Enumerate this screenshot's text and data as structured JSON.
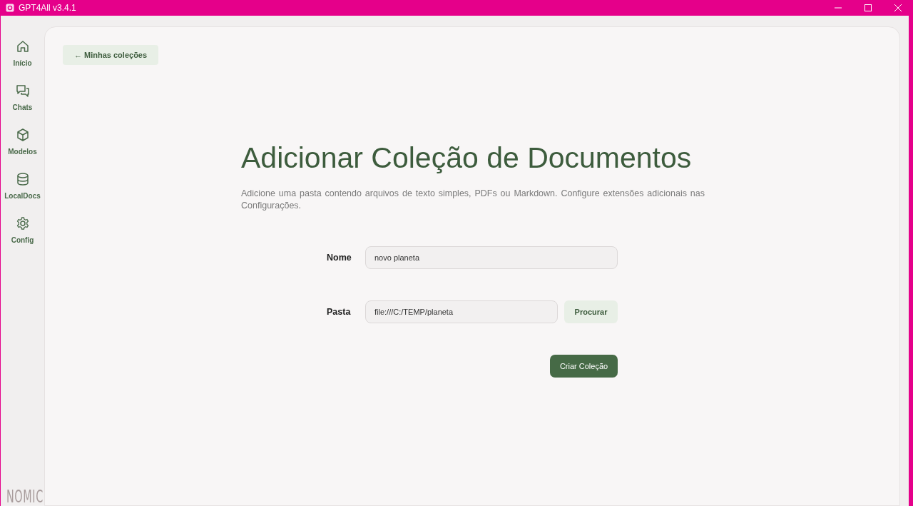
{
  "window": {
    "title": "GPT4All v3.4.1"
  },
  "sidebar": {
    "items": [
      {
        "label": "Início",
        "kind": "home"
      },
      {
        "label": "Chats",
        "kind": "chats"
      },
      {
        "label": "Modelos",
        "kind": "models"
      },
      {
        "label": "LocalDocs",
        "kind": "docs"
      },
      {
        "label": "Config",
        "kind": "settings"
      }
    ],
    "logo": "NOMIC"
  },
  "back_button": "← Minhas coleções",
  "heading": "Adicionar Coleção de Documentos",
  "description": "Adicione uma pasta contendo arquivos de texto simples, PDFs ou Markdown. Configure extensões adicionais nas Configurações.",
  "form": {
    "name": {
      "label": "Nome",
      "value": "novo planeta"
    },
    "folder": {
      "label": "Pasta",
      "value": "file:///C:/TEMP/planeta",
      "browse_button": "Procurar"
    },
    "submit_button": "Criar Coleção"
  }
}
